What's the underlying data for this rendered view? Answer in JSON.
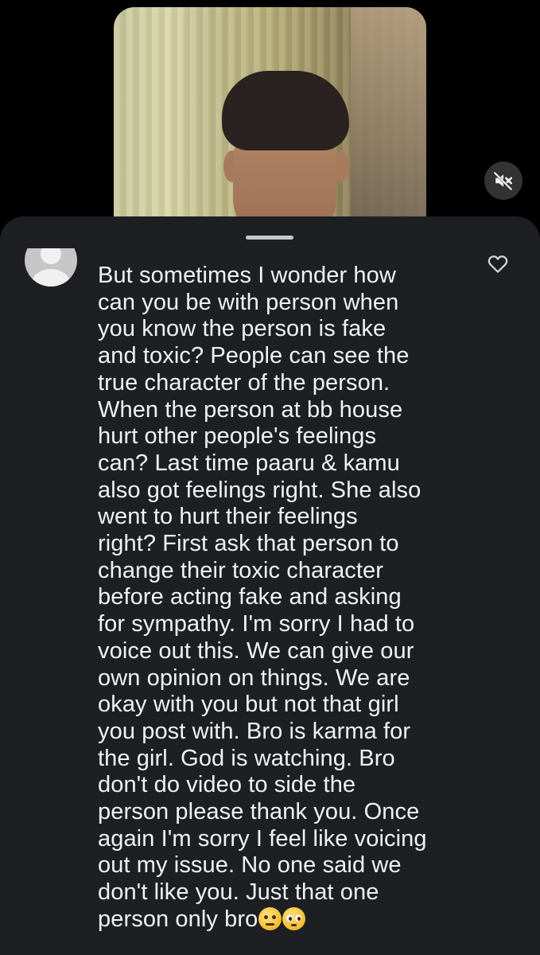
{
  "video": {
    "mute_icon": "speaker-muted-icon"
  },
  "sheet": {
    "handle_icon": "drag-handle"
  },
  "comment": {
    "avatar_icon": "default-user-avatar",
    "like_icon": "heart-outline-icon",
    "text": "But sometimes I wonder how\ncan you be with person when\nyou know the person is fake\nand toxic? People can see the\ntrue character of the person.\nWhen the person at bb house\nhurt other people's feelings\ncan? Last time paaru & kamu\nalso got feelings right. She also\nwent to hurt their feelings\nright? First ask that person to\nchange their toxic character\nbefore acting fake and asking\nfor sympathy. I'm sorry I had to\nvoice out this. We can give our\nown opinion on things. We are\nokay with you but not that girl\nyou post with. Bro is karma for\nthe girl. God is watching. Bro\ndon't do video to side the\nperson please thank you. Once\nagain I'm sorry I feel like voicing\nout my issue. No one said we\ndon't like you. Just that one\nperson only bro",
    "emojis": [
      "unamused-face-emoji",
      "pleading-face-emoji"
    ]
  },
  "colors": {
    "sheet_background": "#1d1f23",
    "text": "#f2f2f2",
    "page_background": "#000000"
  }
}
